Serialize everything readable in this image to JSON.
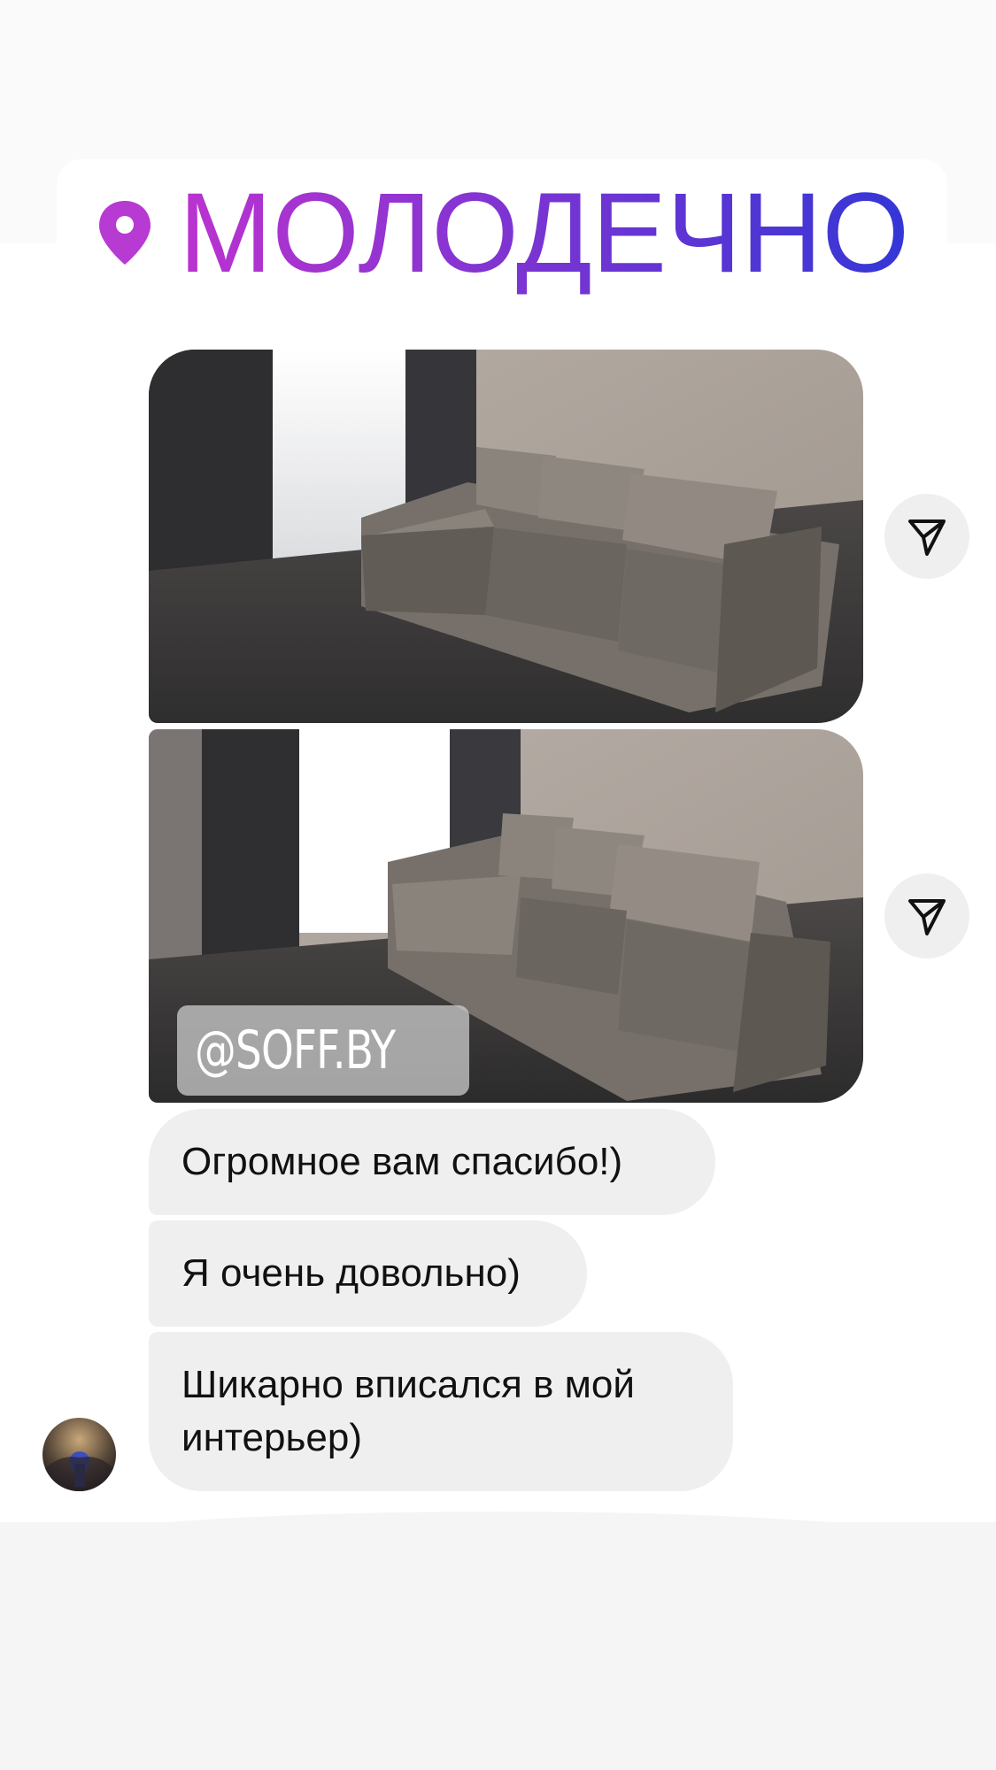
{
  "location_sticker": {
    "text": "МОЛОДЕЧНО",
    "icon": "location-pin-icon",
    "gradient_start": "#b833d1",
    "gradient_end": "#3436d6"
  },
  "messages": {
    "photos": [
      {
        "alt": "sofa-photo",
        "share_icon": "paper-plane-icon"
      },
      {
        "alt": "sofa-photo",
        "share_icon": "paper-plane-icon",
        "watermark": "@SOFF.BY"
      }
    ],
    "texts": [
      "Огромное вам спасибо!)",
      "Я очень довольно)",
      "Шикарно вписался в мой интерьер)"
    ],
    "bubble_color": "#efefef",
    "avatar": "user-avatar"
  }
}
